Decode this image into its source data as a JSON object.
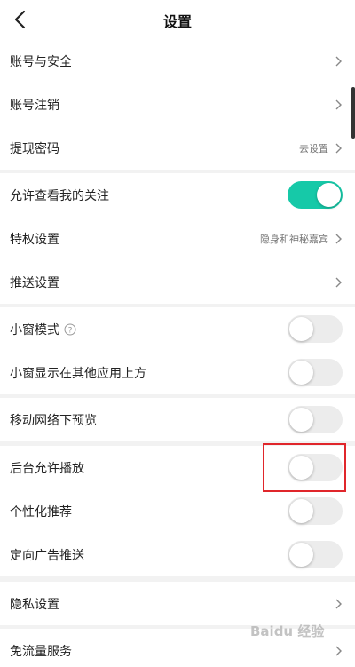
{
  "header": {
    "title": "设置"
  },
  "group1": [
    {
      "label": "账号与安全",
      "value": ""
    },
    {
      "label": "账号注销",
      "value": ""
    },
    {
      "label": "提现密码",
      "value": "去设置"
    }
  ],
  "group2": {
    "allow_follow_label": "允许查看我的关注",
    "privilege_label": "特权设置",
    "privilege_value": "隐身和神秘嘉宾",
    "push_label": "推送设置"
  },
  "group3": {
    "mini_window_label": "小窗模式",
    "mini_window_over_label": "小窗显示在其他应用上方"
  },
  "group4": {
    "mobile_preview_label": "移动网络下预览"
  },
  "group5": {
    "background_play_label": "后台允许播放",
    "personalized_label": "个性化推荐",
    "targeted_ads_label": "定向广告推送"
  },
  "group6": [
    {
      "label": "隐私设置"
    }
  ],
  "group7": [
    {
      "label": "免流量服务"
    }
  ],
  "toggles": {
    "allow_follow": true,
    "mini_window": false,
    "mini_window_over": false,
    "mobile_preview": false,
    "background_play": false,
    "personalized": false,
    "targeted_ads": false
  },
  "colors": {
    "accent": "#16c9a8",
    "highlight": "#e0262b",
    "divider": "#f2f2f2"
  },
  "watermark": "Baidu 经验"
}
